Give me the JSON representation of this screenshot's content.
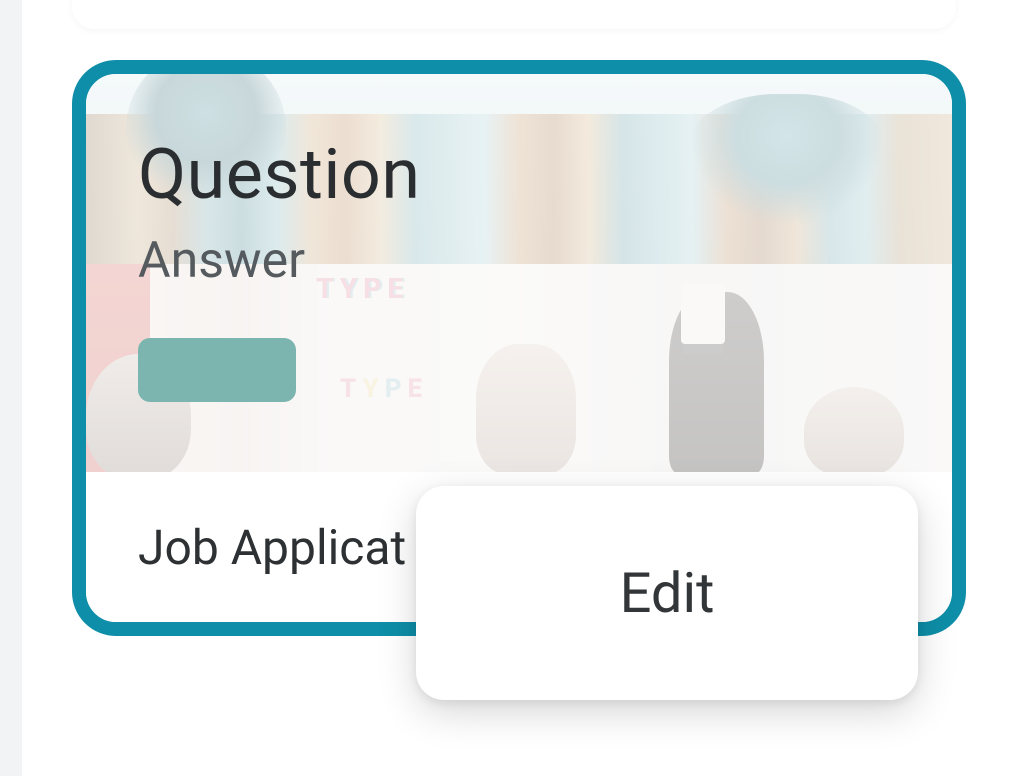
{
  "card": {
    "question_label": "Question",
    "answer_label": "Answer",
    "footer_title": "Job Applicat"
  },
  "menu": {
    "edit_label": "Edit"
  },
  "colors": {
    "card_border": "#0E8EA8",
    "pill": "#7CB5AF"
  }
}
